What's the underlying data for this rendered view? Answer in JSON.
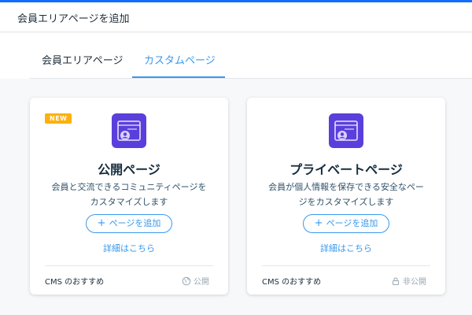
{
  "header": {
    "title": "会員エリアページを追加"
  },
  "tabs": [
    {
      "label": "会員エリアページ",
      "active": false
    },
    {
      "label": "カスタムページ",
      "active": true
    }
  ],
  "cards": [
    {
      "badge": "NEW",
      "icon": "member-page-icon",
      "title": "公開ページ",
      "description_lines": [
        "会員と交流できるコミュニティページを",
        "カスタマイズします"
      ],
      "add_button": "ページを追加",
      "details_link": "詳細はこちら",
      "footer_left": "CMS のおすすめ",
      "footer_right": "公開",
      "footer_right_icon": "globe-icon"
    },
    {
      "badge": "",
      "icon": "member-page-icon",
      "title": "プライベートページ",
      "description_lines": [
        "会員が個人情報を保存できる安全なペー",
        "ジをカスタマイズします"
      ],
      "add_button": "ページを追加",
      "details_link": "詳細はこちら",
      "footer_left": "CMS のおすすめ",
      "footer_right": "非公開",
      "footer_right_icon": "lock-icon"
    }
  ],
  "colors": {
    "accent": "#3899ec",
    "top_accent": "#116dff",
    "icon_bg": "#5b3fdc",
    "badge": "#fdb10c"
  }
}
